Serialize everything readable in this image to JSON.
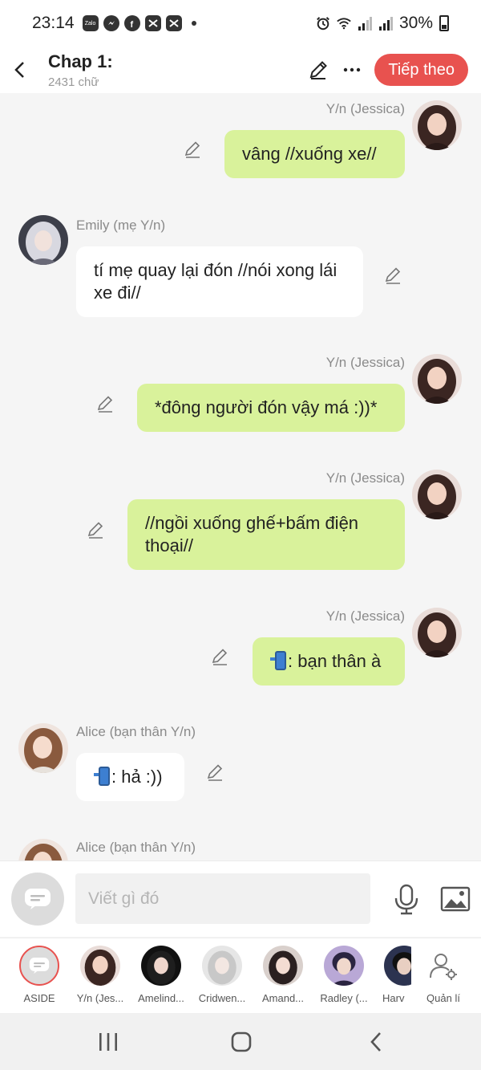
{
  "status_bar": {
    "time": "23:14",
    "apps": [
      "Zalo",
      "Messenger",
      "Facebook",
      "CapCut",
      "CapCut"
    ],
    "battery": "30%"
  },
  "header": {
    "title": "Chap 1:",
    "subtitle": "2431 chữ",
    "next_label": "Tiếp theo"
  },
  "messages": [
    {
      "side": "right",
      "name": "Y/n (Jessica)",
      "text": "vâng //xuống xe//"
    },
    {
      "side": "left",
      "name": "Emily (mẹ Y/n)",
      "text": "tí mẹ quay lại đón //nói xong lái xe đi//"
    },
    {
      "side": "right",
      "name": "Y/n (Jessica)",
      "text": "*đông người đón vậy má :))*"
    },
    {
      "side": "right",
      "name": "Y/n (Jessica)",
      "text": "//ngồi xuống ghế+bấm điện thoại//"
    },
    {
      "side": "right",
      "name": "Y/n (Jessica)",
      "text": ": bạn thân à",
      "emoji": "mobile-phone-arrow"
    },
    {
      "side": "left",
      "name": "Alice (bạn thân Y/n)",
      "text": ": hả :))",
      "emoji": "mobile-phone-arrow"
    },
    {
      "side": "left",
      "name": "Alice (bạn thân Y/n)",
      "text": ""
    }
  ],
  "input": {
    "placeholder": "Viết gì đó"
  },
  "characters": [
    {
      "label": "ASIDE"
    },
    {
      "label": "Y/n (Jes..."
    },
    {
      "label": "Amelind..."
    },
    {
      "label": "Cridwen..."
    },
    {
      "label": "Amand..."
    },
    {
      "label": "Radley (..."
    },
    {
      "label": "Harv"
    },
    {
      "label": "Quản lí"
    }
  ],
  "colors": {
    "accent": "#e8524f",
    "my_bubble": "#d9f29b",
    "other_bubble": "#ffffff",
    "chat_bg": "#f5f5f5"
  }
}
